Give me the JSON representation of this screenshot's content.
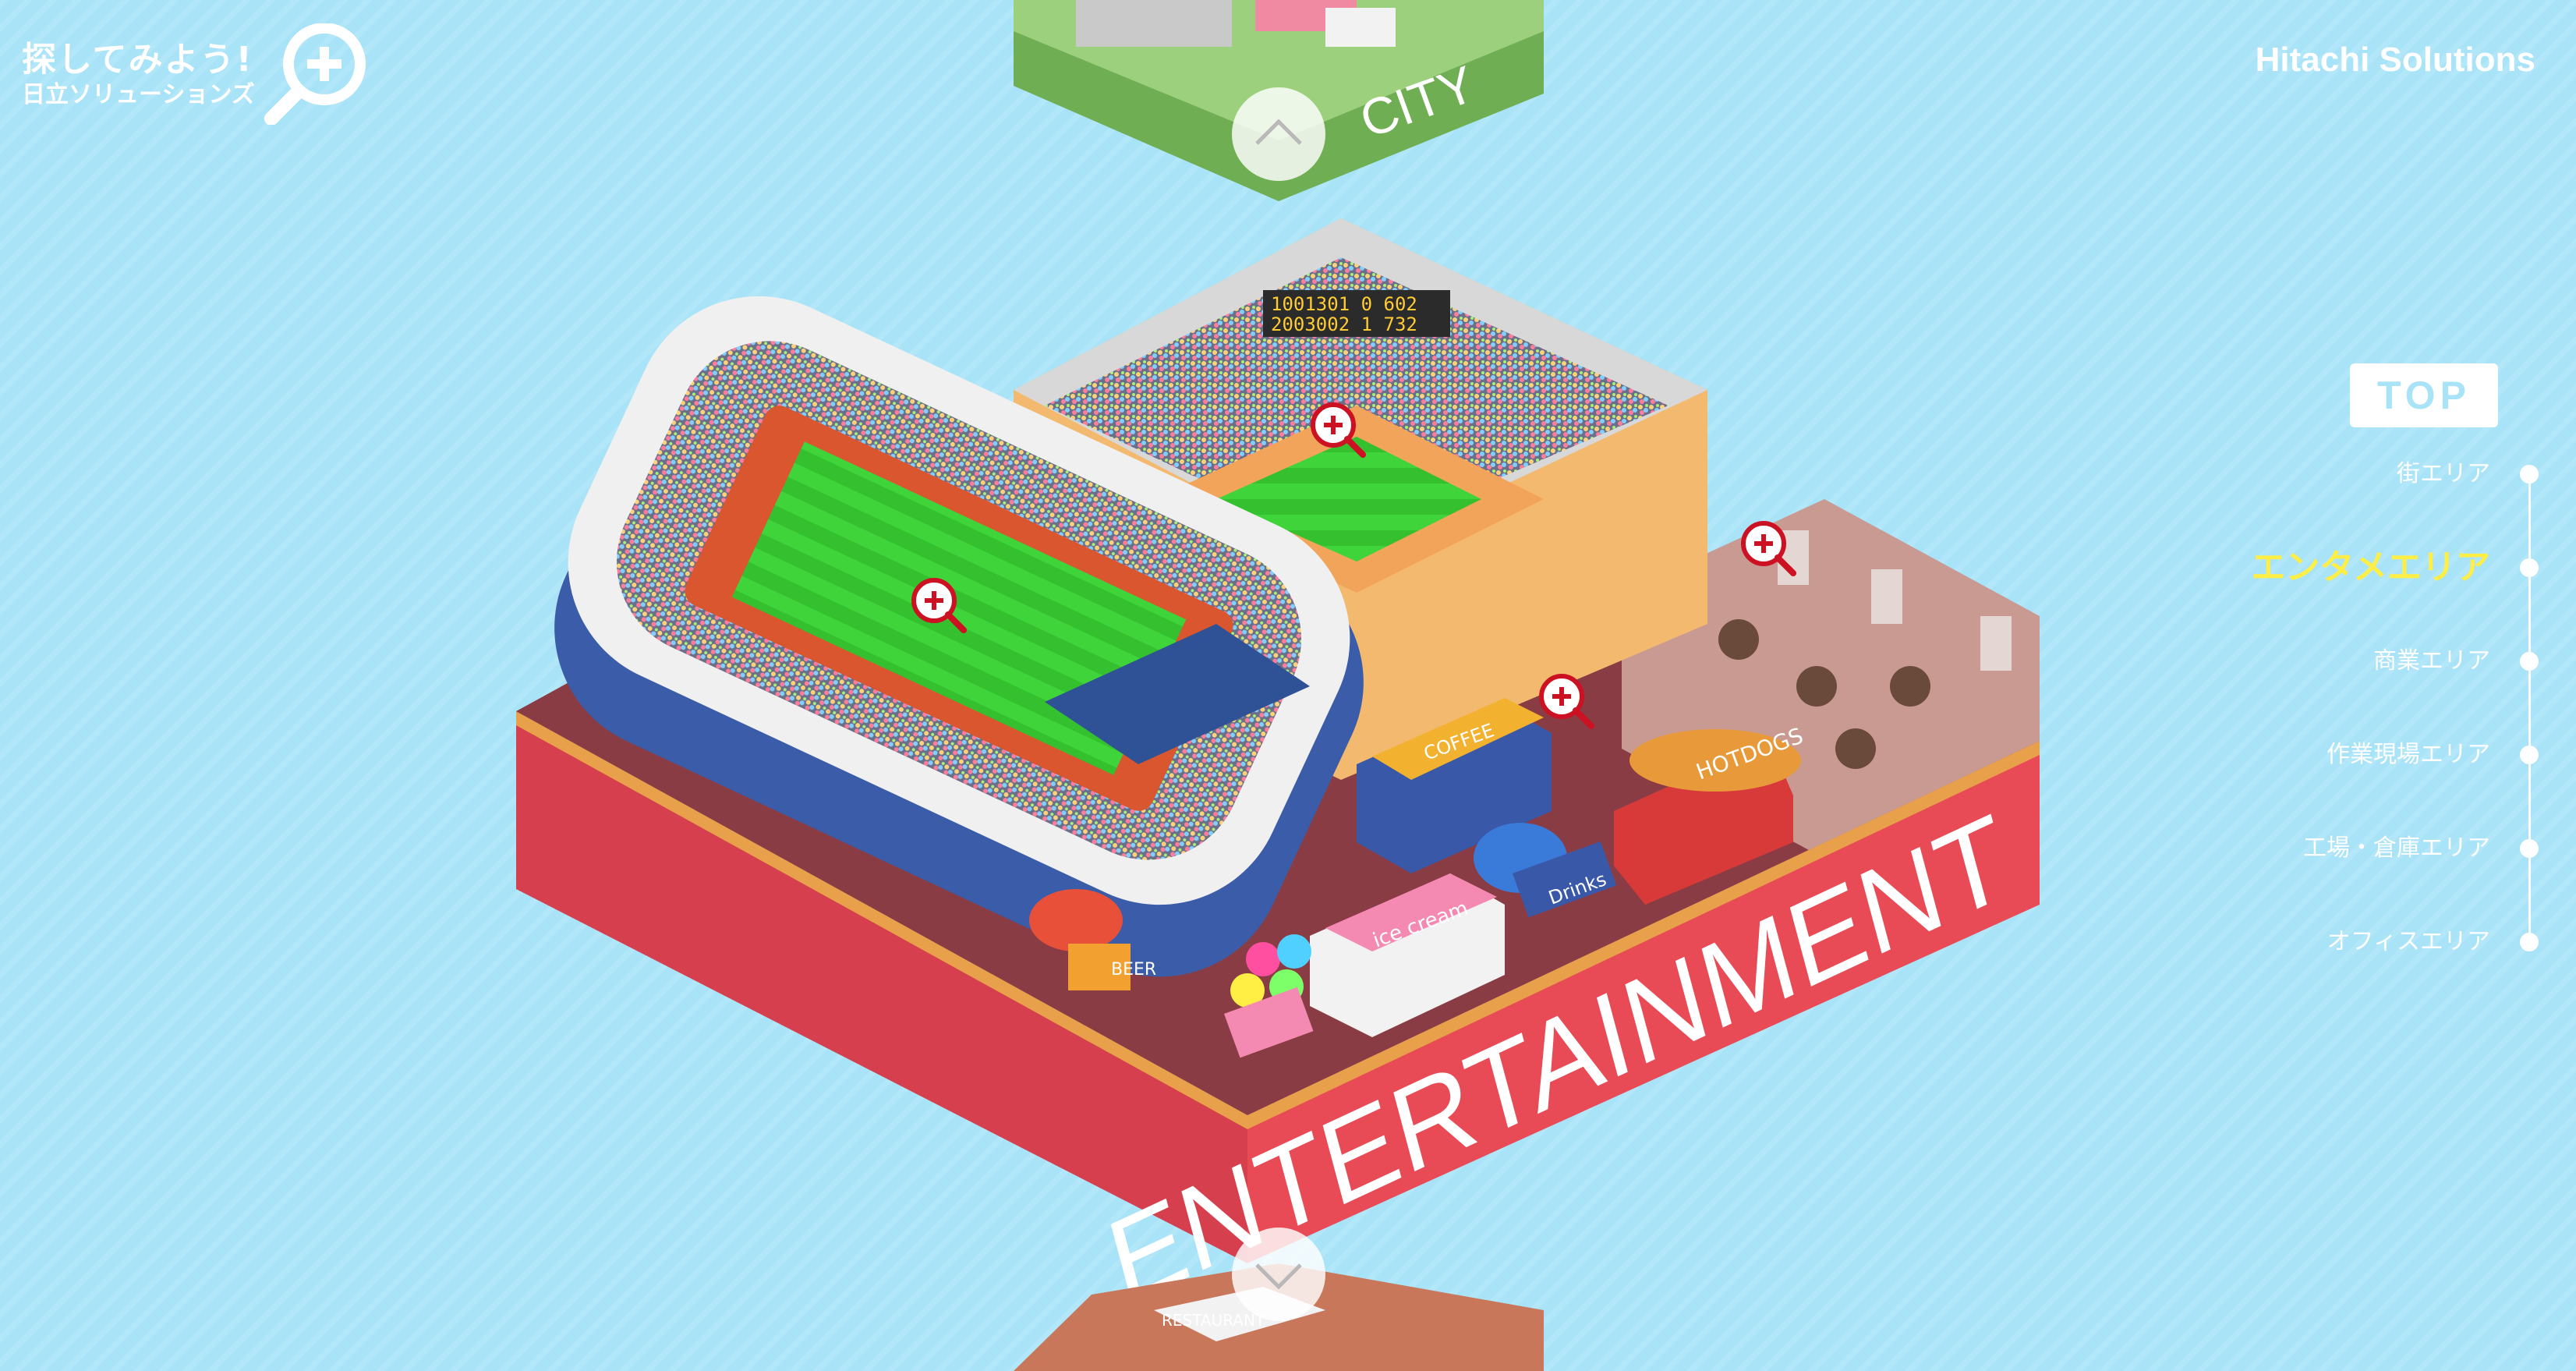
{
  "logo": {
    "line1": "探してみよう!",
    "line2": "日立ソリューションズ",
    "icon": "magnifier-plus-icon"
  },
  "brand": {
    "name": "Hitachi Solutions"
  },
  "scene": {
    "top_area_sign": "CITY",
    "main_area_sign": "ENTERTAINMENT",
    "scoreboard": {
      "row1": "1001301 0 602",
      "row2": "2003002 1 732"
    },
    "signs": {
      "coffee": "COFFEE",
      "hotdogs": "HOTDOGS",
      "ice_cream": "ice cream",
      "drinks": "Drinks",
      "beer": "BEER",
      "restaurant": "RESTAURANT"
    },
    "zoom_icon": "magnifier-plus-icon"
  },
  "nav": {
    "up_icon": "chevron-up-icon",
    "down_icon": "chevron-down-icon"
  },
  "side_nav": {
    "top_label": "TOP",
    "items": [
      {
        "label": "街エリア",
        "active": false
      },
      {
        "label": "エンタメエリア",
        "active": true
      },
      {
        "label": "商業エリア",
        "active": false
      },
      {
        "label": "作業現場エリア",
        "active": false
      },
      {
        "label": "工場・倉庫エリア",
        "active": false
      },
      {
        "label": "オフィスエリア",
        "active": false
      }
    ]
  },
  "colors": {
    "background": "#a9e3f8",
    "platform_red": "#e84a56",
    "active_nav": "#ffee44",
    "zoom_pin": "#cc1122"
  }
}
